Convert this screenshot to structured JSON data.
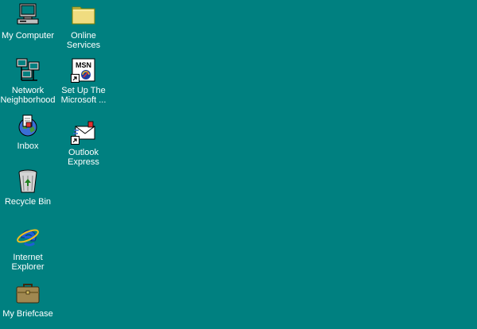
{
  "desktop": {
    "background": "#008080",
    "icons": [
      {
        "id": "my-computer",
        "label": "My Computer",
        "icon": "computer-icon"
      },
      {
        "id": "network-neighborhood",
        "label": "Network\nNeighborhood",
        "icon": "network-icon"
      },
      {
        "id": "inbox",
        "label": "Inbox",
        "icon": "inbox-icon"
      },
      {
        "id": "recycle-bin",
        "label": "Recycle Bin",
        "icon": "recycle-bin-icon"
      },
      {
        "id": "internet-explorer",
        "label": "Internet\nExplorer",
        "icon": "internet-explorer-icon"
      },
      {
        "id": "my-briefcase",
        "label": "My Briefcase",
        "icon": "briefcase-icon"
      },
      {
        "id": "online-services",
        "label": "Online\nServices",
        "icon": "folder-icon"
      },
      {
        "id": "setup-msn",
        "label": "Set Up The\nMicrosoft ...",
        "icon": "msn-icon"
      },
      {
        "id": "outlook-express",
        "label": "Outlook\nExpress",
        "icon": "outlook-express-icon"
      }
    ]
  }
}
